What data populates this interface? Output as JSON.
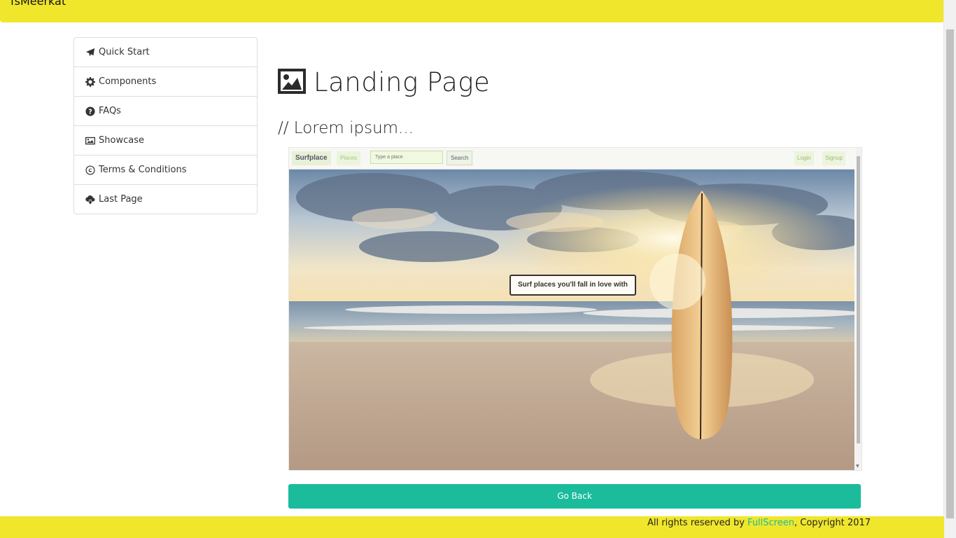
{
  "app": {
    "brand": "fsMeerkat"
  },
  "sidebar": {
    "items": [
      {
        "label": "Quick Start",
        "icon": "paper-plane-icon"
      },
      {
        "label": "Components",
        "icon": "gear-icon"
      },
      {
        "label": "FAQs",
        "icon": "question-circle-icon"
      },
      {
        "label": "Showcase",
        "icon": "image-icon"
      },
      {
        "label": "Terms & Conditions",
        "icon": "copyright-icon"
      },
      {
        "label": "Last Page",
        "icon": "cloud-download-icon"
      }
    ]
  },
  "main": {
    "title": "Landing Page",
    "title_icon": "image-icon",
    "subtitle": "// Lorem ipsum...",
    "go_back_label": "Go Back"
  },
  "preview": {
    "nav": {
      "brand": "Surfplace",
      "places": "Places",
      "search_placeholder": "Type a place",
      "search_button": "Search",
      "login": "Login",
      "signup": "Signup"
    },
    "hero_caption": "Surf places you'll fall in love with"
  },
  "footer": {
    "prefix": "All rights reserved by ",
    "link": "FullScreen",
    "suffix": ", Copyright 2017"
  },
  "colors": {
    "topbar": "#f0e62c",
    "accent": "#1abc9c"
  }
}
